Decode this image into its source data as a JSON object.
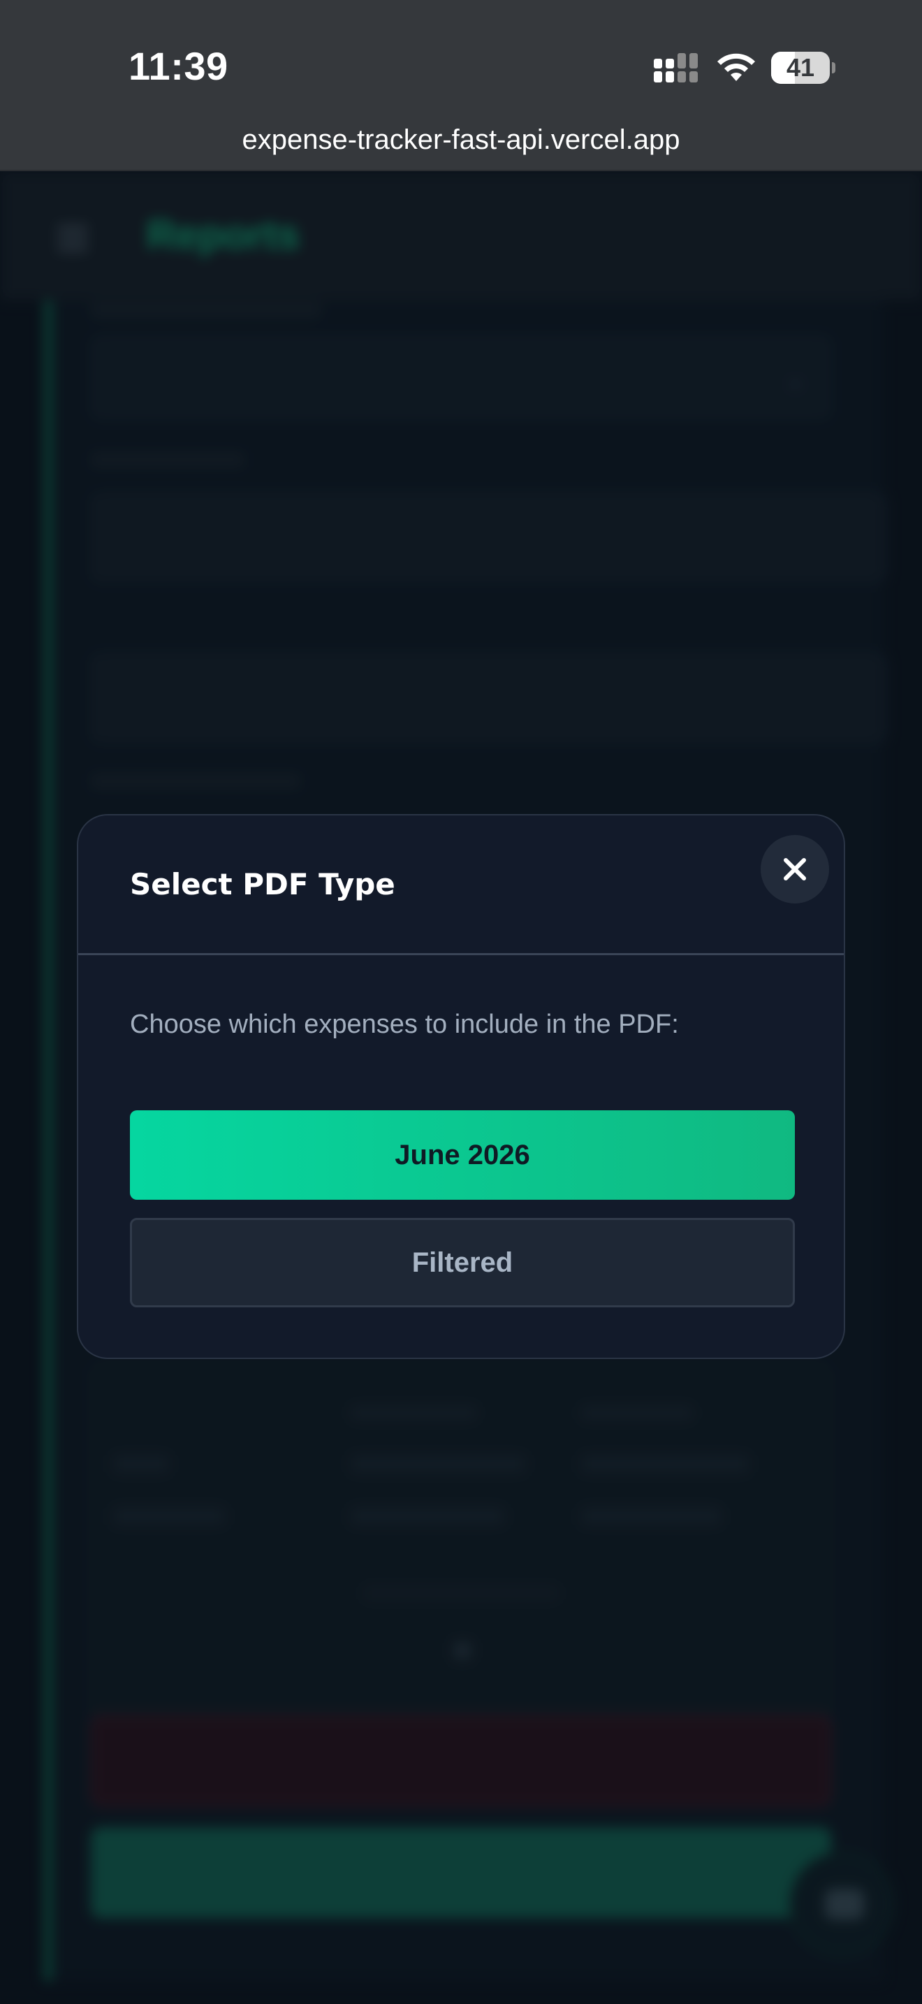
{
  "status_bar": {
    "time": "11:39",
    "battery_level": "41",
    "battery_fraction": 0.41,
    "url": "expense-tracker-fast-api.vercel.app"
  },
  "app": {
    "title": "Reports",
    "accent_color": "#10b981"
  },
  "modal": {
    "title": "Select PDF Type",
    "description": "Choose which expenses to include in the PDF:",
    "options": [
      {
        "label": "June 2026",
        "style": "primary"
      },
      {
        "label": "Filtered",
        "style": "secondary"
      }
    ],
    "close_icon": "close-icon"
  }
}
